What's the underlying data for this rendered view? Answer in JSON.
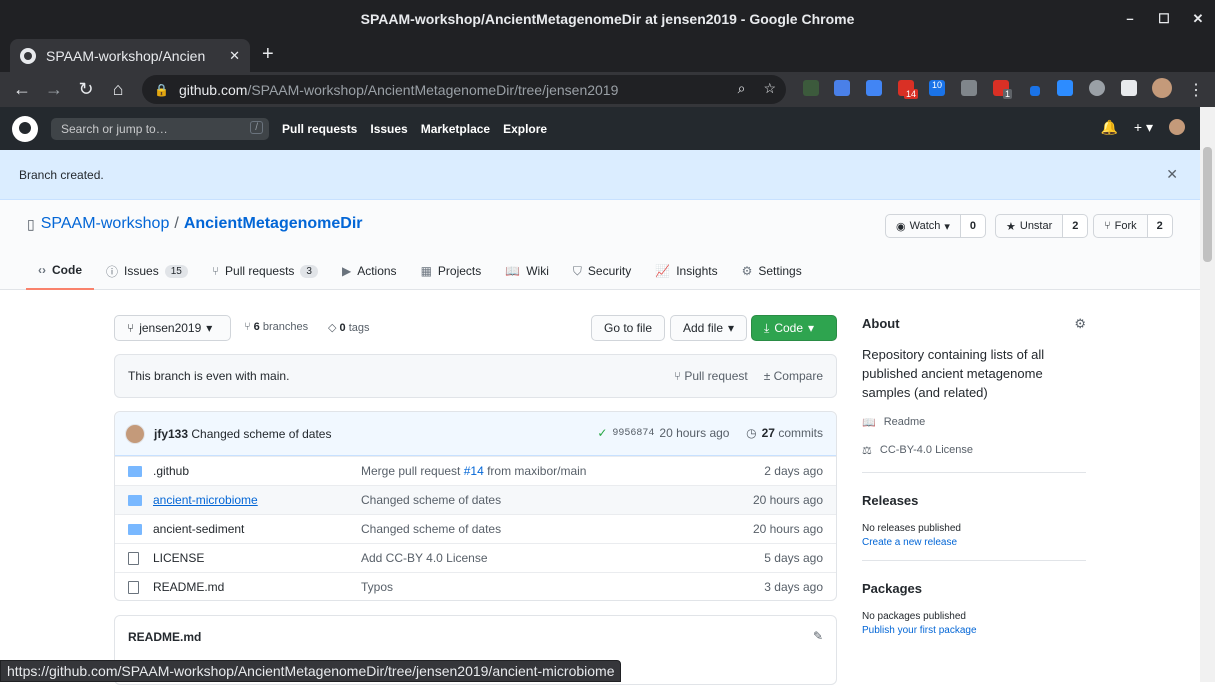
{
  "window": {
    "title": "SPAAM-workshop/AncientMetagenomeDir at jensen2019 - Google Chrome",
    "controls": [
      "–",
      "☐",
      "✕"
    ]
  },
  "tab": {
    "title": "SPAAM-workshop/Ancien",
    "close": "✕",
    "new": "+"
  },
  "omnibox": {
    "host": "github.com",
    "path": "/SPAAM-workshop/AncientMetagenomeDir/tree/jensen2019",
    "badges": {
      "mail": "14",
      "calendar": "10",
      "todo": "1"
    }
  },
  "gh": {
    "search_placeholder": "Search or jump to…",
    "search_key": "/",
    "nav": [
      "Pull requests",
      "Issues",
      "Marketplace",
      "Explore"
    ],
    "flash": "Branch created.",
    "owner": "SPAAM-workshop",
    "repo": "AncientMetagenomeDir",
    "sep": "/",
    "watch": {
      "label": "Watch",
      "count": "0"
    },
    "star": {
      "label": "Unstar",
      "count": "2"
    },
    "fork": {
      "label": "Fork",
      "count": "2"
    },
    "tabs": [
      {
        "label": "Code",
        "icon": "‹›"
      },
      {
        "label": "Issues",
        "count": "15",
        "icon": "ⓘ"
      },
      {
        "label": "Pull requests",
        "count": "3",
        "icon": "⑂"
      },
      {
        "label": "Actions",
        "icon": "▶"
      },
      {
        "label": "Projects",
        "icon": "▦"
      },
      {
        "label": "Wiki",
        "icon": "📖"
      },
      {
        "label": "Security",
        "icon": "⛉"
      },
      {
        "label": "Insights",
        "icon": "📈"
      },
      {
        "label": "Settings",
        "icon": "⚙"
      }
    ],
    "branch": "jensen2019",
    "branches_count": "6",
    "branches_label": "branches",
    "tags_count": "0",
    "tags_label": "tags",
    "goto": "Go to file",
    "addfile": "Add file",
    "code": "Code",
    "even": "This branch is even with main.",
    "pr": "Pull request",
    "compare": "Compare",
    "commit": {
      "author": "jfy133",
      "message": "Changed scheme of dates",
      "sha": "9956874",
      "age": "20 hours ago",
      "count": "27",
      "count_label": "commits"
    },
    "files": [
      {
        "name": ".github",
        "type": "folder",
        "msg": "Merge pull request ",
        "link": "#14",
        "msg2": " from maxibor/main",
        "age": "2 days ago"
      },
      {
        "name": "ancient-microbiome",
        "type": "folder",
        "msg": "Changed scheme of dates",
        "link": "",
        "msg2": "",
        "age": "20 hours ago"
      },
      {
        "name": "ancient-sediment",
        "type": "folder",
        "msg": "Changed scheme of dates",
        "link": "",
        "msg2": "",
        "age": "20 hours ago"
      },
      {
        "name": "LICENSE",
        "type": "file",
        "msg": "Add CC-BY 4.0 License",
        "link": "",
        "msg2": "",
        "age": "5 days ago"
      },
      {
        "name": "README.md",
        "type": "file",
        "msg": "Typos",
        "link": "",
        "msg2": "",
        "age": "3 days ago"
      }
    ],
    "readme_title": "README.md",
    "about": {
      "title": "About",
      "desc": "Repository containing lists of all published ancient metagenome samples (and related)",
      "readme": "Readme",
      "license": "CC-BY-4.0 License"
    },
    "releases": {
      "title": "Releases",
      "none": "No releases published",
      "create": "Create a new release"
    },
    "packages": {
      "title": "Packages",
      "none": "No packages published",
      "publish": "Publish your first package"
    }
  },
  "status_url": "https://github.com/SPAAM-workshop/AncientMetagenomeDir/tree/jensen2019/ancient-microbiome",
  "colors": {
    "accent": "#0366d6",
    "green": "#2ea44f",
    "tab_underline": "#f9826c"
  }
}
